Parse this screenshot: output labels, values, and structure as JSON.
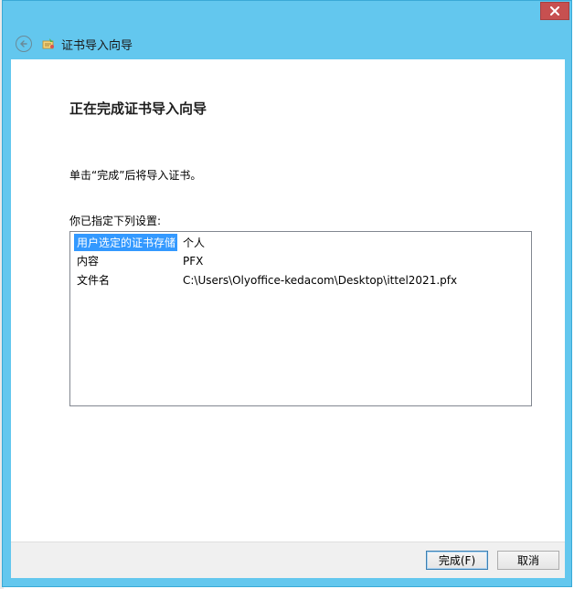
{
  "window": {
    "title": "证书导入向导",
    "close_icon": "close-icon",
    "frame_color": "#63c7ee",
    "close_color": "#c75050"
  },
  "content": {
    "heading": "正在完成证书导入向导",
    "instruction": "单击“完成”后将导入证书。",
    "settings_label": "你已指定下列设置:",
    "settings": [
      {
        "key": "用户选定的证书存储",
        "value": "个人",
        "selected": true
      },
      {
        "key": "内容",
        "value": "PFX",
        "selected": false
      },
      {
        "key": "文件名",
        "value": "C:\\Users\\Olyoffice-kedacom\\Desktop\\ittel2021.pfx",
        "selected": false
      }
    ]
  },
  "buttons": {
    "finish": "完成(F)",
    "cancel": "取消"
  },
  "colors": {
    "selection": "#3399ff"
  }
}
